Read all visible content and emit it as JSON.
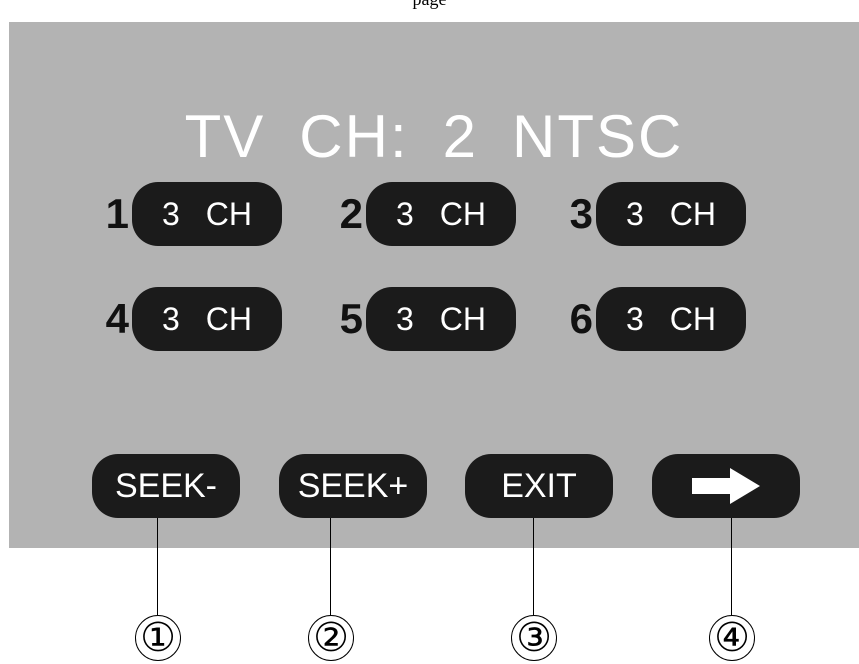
{
  "caption": "page",
  "screen": {
    "title_parts": [
      "TV",
      "CH:",
      "2",
      "NTSC"
    ],
    "presets": [
      {
        "num": "1",
        "value": "3",
        "unit": "CH"
      },
      {
        "num": "2",
        "value": "3",
        "unit": "CH"
      },
      {
        "num": "3",
        "value": "3",
        "unit": "CH"
      },
      {
        "num": "4",
        "value": "3",
        "unit": "CH"
      },
      {
        "num": "5",
        "value": "3",
        "unit": "CH"
      },
      {
        "num": "6",
        "value": "3",
        "unit": "CH"
      }
    ],
    "buttons": {
      "seek_minus": "SEEK-",
      "seek_plus": "SEEK+",
      "exit": "EXIT",
      "next_icon": "right-arrow-icon"
    }
  },
  "callouts": [
    "①",
    "②",
    "③",
    "④"
  ],
  "colors": {
    "screen_bg": "#b3b3b3",
    "button_bg": "#1b1b1b",
    "text_light": "#ffffff"
  }
}
